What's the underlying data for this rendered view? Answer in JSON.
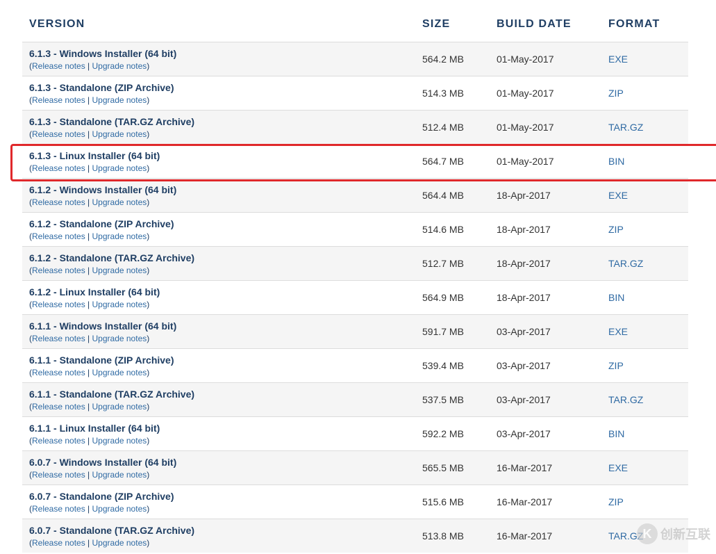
{
  "headers": {
    "version": "VERSION",
    "size": "SIZE",
    "build_date": "BUILD DATE",
    "format": "FORMAT"
  },
  "notes": {
    "open": "(",
    "release": "Release notes",
    "sep": " | ",
    "upgrade": "Upgrade notes",
    "close": ")"
  },
  "highlight_color": "#e0282b",
  "rows": [
    {
      "title": "6.1.3 - Windows Installer (64 bit)",
      "size": "564.2 MB",
      "date": "01-May-2017",
      "format": "EXE"
    },
    {
      "title": "6.1.3 - Standalone (ZIP Archive)",
      "size": "514.3 MB",
      "date": "01-May-2017",
      "format": "ZIP"
    },
    {
      "title": "6.1.3 - Standalone (TAR.GZ Archive)",
      "size": "512.4 MB",
      "date": "01-May-2017",
      "format": "TAR.GZ"
    },
    {
      "title": "6.1.3 - Linux Installer (64 bit)",
      "size": "564.7 MB",
      "date": "01-May-2017",
      "format": "BIN",
      "highlighted": true
    },
    {
      "title": "6.1.2 - Windows Installer (64 bit)",
      "size": "564.4 MB",
      "date": "18-Apr-2017",
      "format": "EXE"
    },
    {
      "title": "6.1.2 - Standalone (ZIP Archive)",
      "size": "514.6 MB",
      "date": "18-Apr-2017",
      "format": "ZIP"
    },
    {
      "title": "6.1.2 - Standalone (TAR.GZ Archive)",
      "size": "512.7 MB",
      "date": "18-Apr-2017",
      "format": "TAR.GZ"
    },
    {
      "title": "6.1.2 - Linux Installer (64 bit)",
      "size": "564.9 MB",
      "date": "18-Apr-2017",
      "format": "BIN"
    },
    {
      "title": "6.1.1 - Windows Installer (64 bit)",
      "size": "591.7 MB",
      "date": "03-Apr-2017",
      "format": "EXE"
    },
    {
      "title": "6.1.1 - Standalone (ZIP Archive)",
      "size": "539.4 MB",
      "date": "03-Apr-2017",
      "format": "ZIP"
    },
    {
      "title": "6.1.1 - Standalone (TAR.GZ Archive)",
      "size": "537.5 MB",
      "date": "03-Apr-2017",
      "format": "TAR.GZ"
    },
    {
      "title": "6.1.1 - Linux Installer (64 bit)",
      "size": "592.2 MB",
      "date": "03-Apr-2017",
      "format": "BIN"
    },
    {
      "title": "6.0.7 - Windows Installer (64 bit)",
      "size": "565.5 MB",
      "date": "16-Mar-2017",
      "format": "EXE"
    },
    {
      "title": "6.0.7 - Standalone (ZIP Archive)",
      "size": "515.6 MB",
      "date": "16-Mar-2017",
      "format": "ZIP"
    },
    {
      "title": "6.0.7 - Standalone (TAR.GZ Archive)",
      "size": "513.8 MB",
      "date": "16-Mar-2017",
      "format": "TAR.GZ"
    }
  ],
  "watermark": {
    "glyph": "K",
    "text": "创新互联"
  }
}
